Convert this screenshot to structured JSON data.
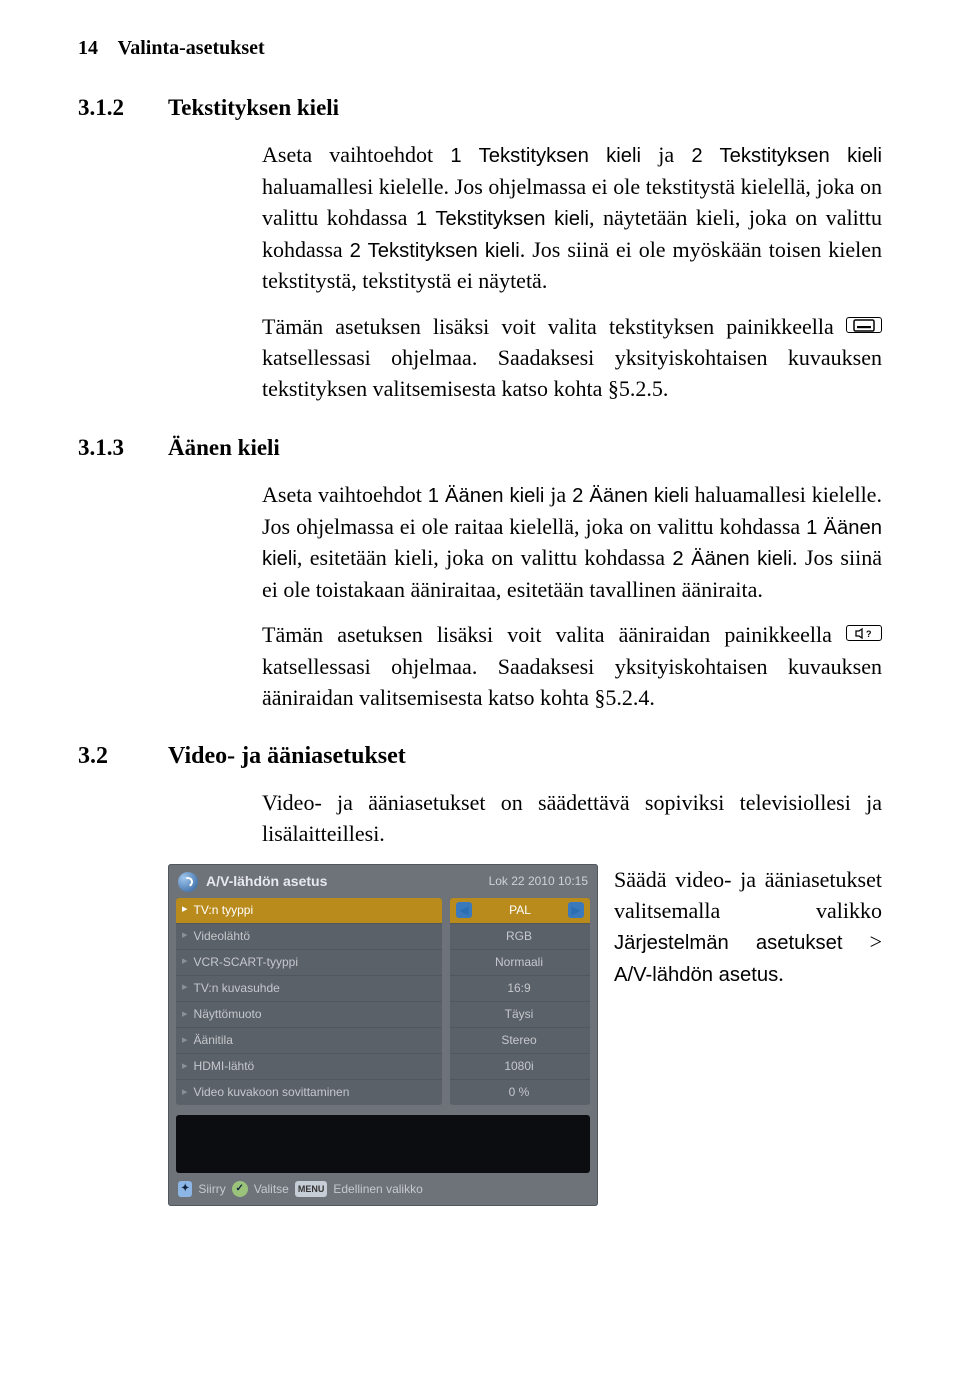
{
  "header": {
    "page_num": "14",
    "running": "Valinta-asetukset"
  },
  "s312": {
    "num": "3.1.2",
    "title": "Tekstityksen kieli",
    "p1a": "Aseta vaihtoehdot ",
    "p1b": "1 Tekstityksen kieli",
    "p1c": " ja ",
    "p1d": "2 Tekstityksen kieli",
    "p1e": " haluamallesi kielelle. Jos ohjelmassa ei ole tekstitystä kielellä, joka on valittu kohdassa ",
    "p1f": "1 Tekstityksen kieli",
    "p1g": ", näytetään kieli, joka on valittu kohdassa ",
    "p1h": "2 Tekstityksen kieli",
    "p1i": ". Jos siinä ei ole myöskään toisen kielen tekstitystä, tekstitystä ei näytetä.",
    "p2a": "Tämän asetuksen lisäksi voit valita tekstityksen painikkeella ",
    "p2b": " katsellessasi ohjelmaa. Saadaksesi yksityiskohtaisen kuvauksen tekstityksen valitsemisesta katso kohta §5.2.5."
  },
  "s313": {
    "num": "3.1.3",
    "title": "Äänen kieli",
    "p1a": "Aseta vaihtoehdot ",
    "p1b": "1 Äänen kieli",
    "p1c": " ja ",
    "p1d": "2 Äänen kieli",
    "p1e": " haluamallesi kielelle. Jos ohjelmassa ei ole raitaa kielellä, joka on valittu kohdassa ",
    "p1f": "1 Äänen kieli",
    "p1g": ", esitetään kieli, joka on valittu kohdassa ",
    "p1h": "2 Äänen kieli",
    "p1i": ". Jos siinä ei ole toistakaan ääniraitaa, esitetään tavallinen ääniraita.",
    "p2a": "Tämän asetuksen lisäksi voit valita ääniraidan painikkeella ",
    "p2b": " katsellessasi ohjelmaa. Saadaksesi yksityiskohtaisen kuvauksen ääniraidan valitsemisesta katso kohta §5.2.4."
  },
  "s32": {
    "num": "3.2",
    "title": "Video- ja ääniasetukset",
    "intro": "Video- ja ääniasetukset on säädettävä sopiviksi televisiollesi ja lisälaitteillesi.",
    "right_a": "Säädä video- ja ääniasetukset valitsemalla valikko ",
    "right_b": "Järjestelmän asetukset",
    "right_gt": " > ",
    "right_c": "A/V-lähdön asetus",
    "right_d": "."
  },
  "shot": {
    "title": "A/V-lähdön asetus",
    "clock": "Lok 22 2010 10:15",
    "rows": [
      {
        "label": "TV:n tyyppi",
        "value": "PAL",
        "selected": true
      },
      {
        "label": "Videolähtö",
        "value": "RGB",
        "selected": false
      },
      {
        "label": "VCR-SCART-tyyppi",
        "value": "Normaali",
        "selected": false
      },
      {
        "label": "TV:n kuvasuhde",
        "value": "16:9",
        "selected": false
      },
      {
        "label": "Näyttömuoto",
        "value": "Täysi",
        "selected": false
      },
      {
        "label": "Äänitila",
        "value": "Stereo",
        "selected": false
      },
      {
        "label": "HDMI-lähtö",
        "value": "1080i",
        "selected": false
      },
      {
        "label": "Video kuvakoon sovittaminen",
        "value": "0 %",
        "selected": false
      }
    ],
    "legend": {
      "siirry": "Siirry",
      "valitse": "Valitse",
      "menu": "MENU",
      "back": "Edellinen valikko"
    }
  }
}
